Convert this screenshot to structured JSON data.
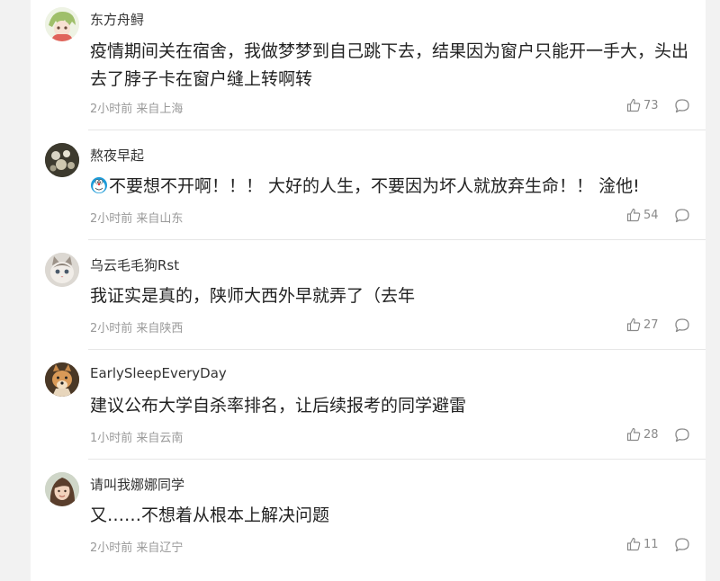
{
  "comments": [
    {
      "username": "东方舟鲟",
      "text": "疫情期间关在宿舍，我做梦梦到自己跳下去，结果因为窗户只能开一手大，头出去了脖子卡在窗户缝上转啊转",
      "meta": "2小时前 来自上海",
      "likes": "73"
    },
    {
      "username": "熬夜早起",
      "text": "不要想不开啊！！！ 大好的人生，不要因为坏人就放弃生命！！ 淦他!",
      "emoji": "doraemon-emoji-icon",
      "meta": "2小时前 来自山东",
      "likes": "54"
    },
    {
      "username": "乌云毛毛狗Rst",
      "text": "我证实是真的，陕师大西外早就弄了（去年",
      "meta": "2小时前 来自陕西",
      "likes": "27"
    },
    {
      "username": "EarlySleepEveryDay",
      "text": "建议公布大学自杀率排名，让后续报考的同学避雷",
      "meta": "1小时前 来自云南",
      "likes": "28"
    },
    {
      "username": "请叫我娜娜同学",
      "text": "又……不想着从根本上解决问题",
      "meta": "2小时前 来自辽宁",
      "likes": "11"
    }
  ],
  "icons": {
    "like": "thumbs-up-icon",
    "reply": "comment-bubble-icon"
  }
}
